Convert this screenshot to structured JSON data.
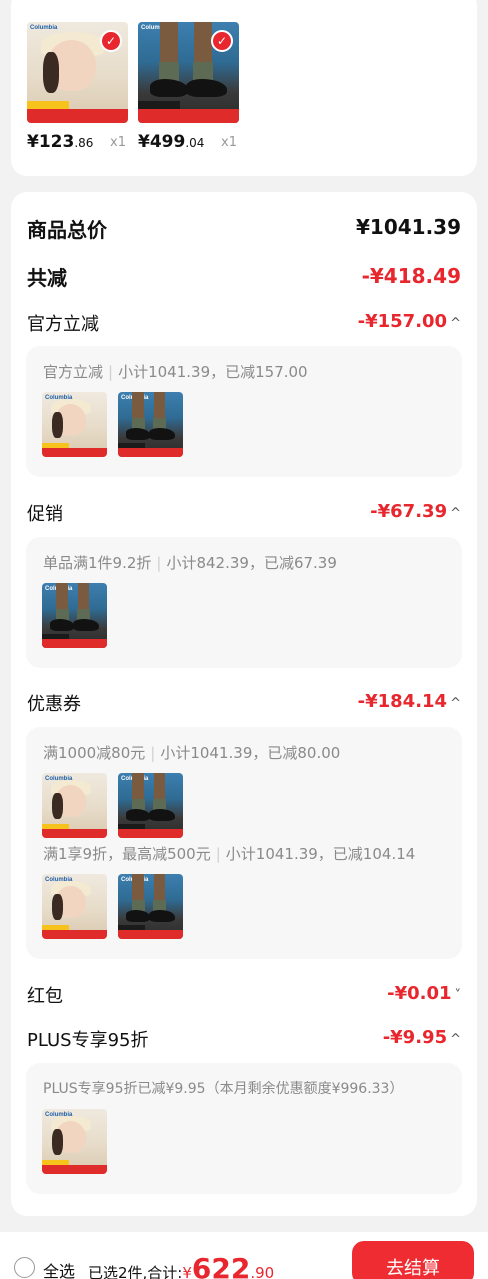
{
  "selected_items": [
    {
      "name": "hat",
      "price_int": "¥123",
      "price_dec": ".86",
      "qty": "x1"
    },
    {
      "name": "shoe",
      "price_int": "¥499",
      "price_dec": ".04",
      "qty": "x1"
    }
  ],
  "brand_text": "Columbia",
  "summary": {
    "total_label": "商品总价",
    "total_value": "¥1041.39",
    "discount_label": "共减",
    "discount_value": "-¥418.49"
  },
  "sections": {
    "official": {
      "label": "官方立减",
      "value": "-¥157.00",
      "chevron": "^",
      "detail_a": "官方立减",
      "detail_b": "小计1041.39，已减157.00"
    },
    "promo": {
      "label": "促销",
      "value": "-¥67.39",
      "chevron": "^",
      "detail_a": "单品满1件9.2折",
      "detail_b": "小计842.39，已减67.39"
    },
    "coupon": {
      "label": "优惠券",
      "value": "-¥184.14",
      "chevron": "^",
      "line1_a": "满1000减80元",
      "line1_b": "小计1041.39，已减80.00",
      "line2_a": "满1享9折，最高减500元",
      "line2_b": "小计1041.39，已减104.14"
    },
    "redpacket": {
      "label": "红包",
      "value": "-¥0.01",
      "chevron": "˅"
    },
    "plus": {
      "label": "PLUS专享95折",
      "value": "-¥9.95",
      "chevron": "^",
      "detail": "PLUS专享95折已减¥9.95（本月剩余优惠额度¥996.33）"
    }
  },
  "bottom_bar": {
    "select_all": "全选",
    "selected_text": "已选2件,合计:",
    "currency": "¥",
    "amount_int": "622",
    "amount_dec": ".90",
    "checkout_label": "去结算"
  },
  "colors": {
    "accent": "#e8262d",
    "checkout_bg": "#ee2c31"
  }
}
